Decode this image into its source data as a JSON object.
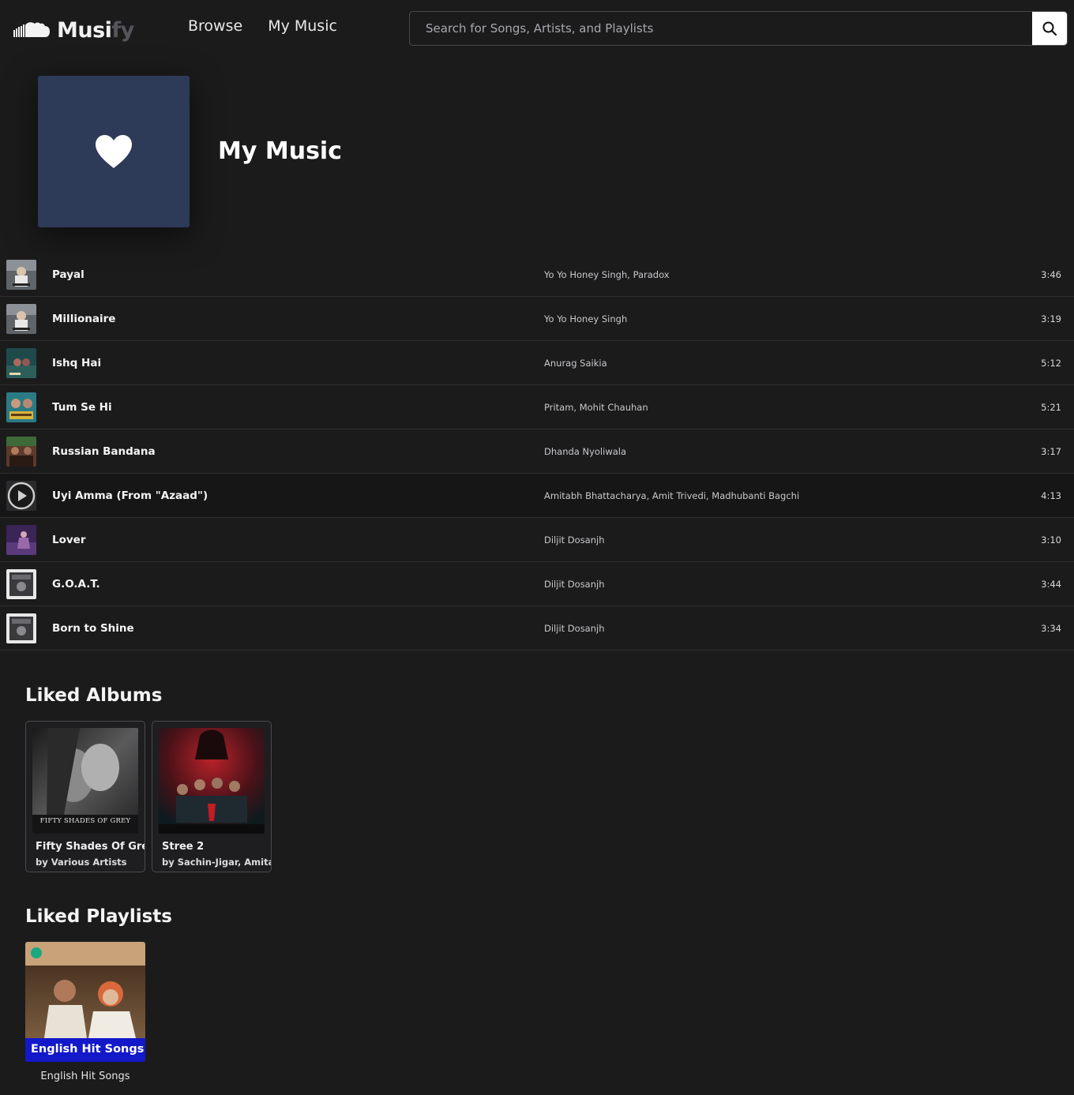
{
  "header": {
    "logo_text_a": "Musi",
    "logo_text_b": "fy",
    "nav": [
      "Browse",
      "My Music"
    ],
    "search_placeholder": "Search for Songs, Artists, and Playlists"
  },
  "hero": {
    "title": "My Music"
  },
  "tracks": [
    {
      "name": "Payal",
      "artist": "Yo Yo Honey Singh, Paradox",
      "duration": "3:46"
    },
    {
      "name": "Millionaire",
      "artist": "Yo Yo Honey Singh",
      "duration": "3:19"
    },
    {
      "name": "Ishq Hai",
      "artist": "Anurag Saikia",
      "duration": "5:12"
    },
    {
      "name": "Tum Se Hi",
      "artist": "Pritam, Mohit Chauhan",
      "duration": "5:21"
    },
    {
      "name": "Russian Bandana",
      "artist": "Dhanda Nyoliwala",
      "duration": "3:17"
    },
    {
      "name": "Uyi Amma (From \"Azaad\")",
      "artist": "Amitabh Bhattacharya, Amit Trivedi, Madhubanti Bagchi",
      "duration": "4:13"
    },
    {
      "name": "Lover",
      "artist": "Diljit Dosanjh",
      "duration": "3:10"
    },
    {
      "name": "G.O.A.T.",
      "artist": "Diljit Dosanjh",
      "duration": "3:44"
    },
    {
      "name": "Born to Shine",
      "artist": "Diljit Dosanjh",
      "duration": "3:34"
    }
  ],
  "liked_albums": {
    "title": "Liked Albums",
    "items": [
      {
        "name": "Fifty Shades Of Grey",
        "by": "by Various Artists",
        "art_text": "FIFTY SHADES OF GREY"
      },
      {
        "name": "Stree 2",
        "by": "by Sachin-Jigar, Amitabh"
      }
    ]
  },
  "liked_playlists": {
    "title": "Liked Playlists",
    "items": [
      {
        "name": "English Hit Songs",
        "art_text": "English Hit Songs"
      }
    ]
  },
  "colors": {
    "background": "#1b1b1c",
    "hero_cover": "#2d3a58",
    "playlist_band": "#1318c9"
  },
  "icons": {
    "logo": "cloud-icon",
    "search": "search-icon",
    "hero": "heart-icon",
    "now_playing": "play-icon"
  }
}
